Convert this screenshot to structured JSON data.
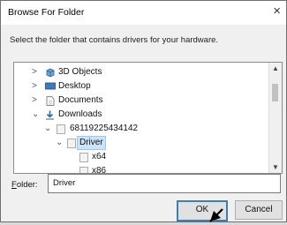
{
  "window": {
    "title": "Browse For Folder",
    "close_symbol": "×"
  },
  "instruction": "Select the folder that contains drivers for your hardware.",
  "tree": {
    "items": [
      {
        "label": "3D Objects",
        "chevron": ">",
        "icon": "3d-objects-icon"
      },
      {
        "label": "Desktop",
        "chevron": ">",
        "icon": "desktop-icon"
      },
      {
        "label": "Documents",
        "chevron": ">",
        "icon": "documents-icon"
      },
      {
        "label": "Downloads",
        "chevron": "⌄",
        "icon": "downloads-icon"
      },
      {
        "label": "68119225434142",
        "chevron": "⌄",
        "icon": "folder-icon"
      },
      {
        "label": "Driver",
        "chevron": "⌄",
        "icon": "folder-icon",
        "selected": true
      },
      {
        "label": "x64",
        "chevron": "",
        "icon": "folder-icon"
      },
      {
        "label": "x86",
        "chevron": "",
        "icon": "folder-icon"
      }
    ]
  },
  "folder": {
    "label": "Folder:",
    "label_accesskey": "F",
    "label_rest": "older:",
    "value": "Driver"
  },
  "buttons": {
    "ok": "OK",
    "cancel": "Cancel"
  },
  "colors": {
    "selection": "#cce4f7",
    "ok_border": "#3c7fb1"
  }
}
